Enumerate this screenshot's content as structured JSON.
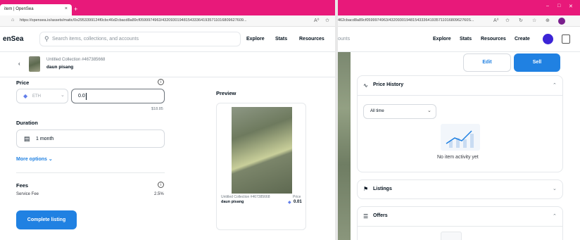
{
  "left_window": {
    "tab": {
      "title": "item | OpenSea",
      "close": "×",
      "new_tab": "+"
    },
    "address": {
      "lock": "⌂",
      "url": "https://opensea.io/assets/matic/0x2953399124f0cbc46d2cbacd8a89cf0599974963/43209301948154333641935711016809627609...",
      "read_aloud": "A⁰",
      "favorites": "✩"
    },
    "nav": {
      "brand": "enSea",
      "search_placeholder": "Search items, collections, and accounts",
      "links": [
        "Explore",
        "Stats",
        "Resources"
      ]
    },
    "header": {
      "back": "‹",
      "collection": "Untitled Collection #467385668",
      "item_name": "daun pisang"
    },
    "form": {
      "price_label": "Price",
      "currency": "ETH",
      "currency_caret": "⌄",
      "price_value": "0.0",
      "usd_value": "$18.85",
      "duration_label": "Duration",
      "duration_value": "1 month",
      "more_options": "More options ⌄",
      "fees_label": "Fees",
      "service_fee_label": "Service Fee",
      "service_fee_value": "2.5%",
      "complete_button": "Complete listing"
    },
    "preview": {
      "label": "Preview",
      "collection": "Untitled Collection #467385668",
      "name": "daun pisang",
      "price_label": "Price",
      "price_value": "0.01"
    }
  },
  "right_window": {
    "address": {
      "url": "462cbacd8a89cf0599974963/4320930194815433364193571101680962760S...",
      "icons": [
        "A⁰",
        "✩",
        "↻",
        "☆",
        "⊕"
      ]
    },
    "nav": {
      "search_fragment": "ounts",
      "links": [
        "Explore",
        "Stats",
        "Resources",
        "Create"
      ]
    },
    "actions": {
      "edit": "Edit",
      "sell": "Sell"
    },
    "price_history": {
      "title": "Price History",
      "filter": "All time",
      "empty": "No item activity yet"
    },
    "listings": {
      "title": "Listings"
    },
    "offers": {
      "title": "Offers"
    }
  },
  "colors": {
    "tab_bar": "#e8197a",
    "accent_blue": "#2081e2",
    "eth": "#627eea"
  }
}
